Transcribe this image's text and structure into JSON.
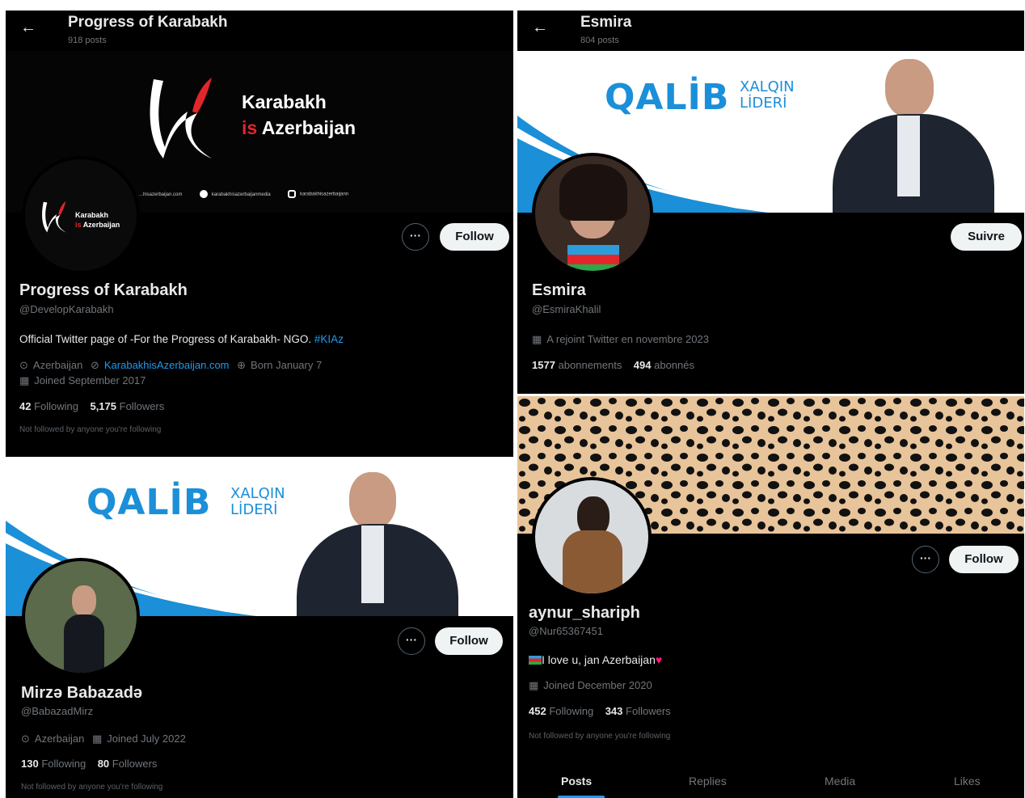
{
  "p1": {
    "title": "Progress of Karabakh",
    "posts": "918 posts",
    "banner_line1": "Karabakh",
    "banner_line2_a": "is",
    "banner_line2_b": "Azerbaijan",
    "banner_links": [
      "...hisazerbaijan.com",
      "karabakhisazerbaijanmedia",
      "karabakhisazerbaijann"
    ],
    "avatar_line1": "Karabakh",
    "avatar_line2_a": "is",
    "avatar_line2_b": "Azerbaijan",
    "follow_label": "Follow",
    "name": "Progress of Karabakh",
    "handle": "@DevelopKarabakh",
    "bio_text": "Official Twitter page of -For the Progress of Karabakh- NGO.",
    "bio_tag": "#KIAz",
    "location": "Azerbaijan",
    "website": "KarabakhisAzerbaijan.com",
    "born": "Born January 7",
    "joined": "Joined September 2017",
    "following_count": "42",
    "following_label": "Following",
    "followers_count": "5,175",
    "followers_label": "Followers",
    "not_followed": "Not followed by anyone you're following"
  },
  "p2": {
    "title": "Esmira",
    "posts": "804 posts",
    "banner_big": "QALİB",
    "banner_small1": "XALQIN",
    "banner_small2": "LİDERİ",
    "follow_label": "Suivre",
    "name": "Esmira",
    "handle": "@EsmiraKhalil",
    "joined": "A rejoint Twitter en novembre 2023",
    "following_count": "1577",
    "following_label": "abonnements",
    "followers_count": "494",
    "followers_label": "abonnés"
  },
  "p3": {
    "banner_big": "QALİB",
    "banner_small1": "XALQIN",
    "banner_small2": "LİDERİ",
    "follow_label": "Follow",
    "name": "Mirzə Babazadə",
    "handle": "@BabazadMirz",
    "location": "Azerbaijan",
    "joined": "Joined July 2022",
    "following_count": "130",
    "following_label": "Following",
    "followers_count": "80",
    "followers_label": "Followers",
    "not_followed": "Not followed by anyone you're following"
  },
  "p4": {
    "follow_label": "Follow",
    "name": "aynur_shariph",
    "handle": "@Nur65367451",
    "bio": "I love u, jan Azerbaijan",
    "joined": "Joined December 2020",
    "following_count": "452",
    "following_label": "Following",
    "followers_count": "343",
    "followers_label": "Followers",
    "not_followed": "Not followed by anyone you're following",
    "tabs": [
      "Posts",
      "Replies",
      "Media",
      "Likes"
    ]
  },
  "icons": {
    "back": "←",
    "more": "···",
    "location": "⊙",
    "link": "⊘",
    "born": "⊕",
    "calendar": "▦"
  },
  "colors": {
    "background": "#000000",
    "accent": "#1d9bf0",
    "banner_blue": "#1b8fd8",
    "karabakh_red": "#e2262b",
    "follow_bg": "#eff3f4",
    "leopard": "#e8c49a"
  }
}
